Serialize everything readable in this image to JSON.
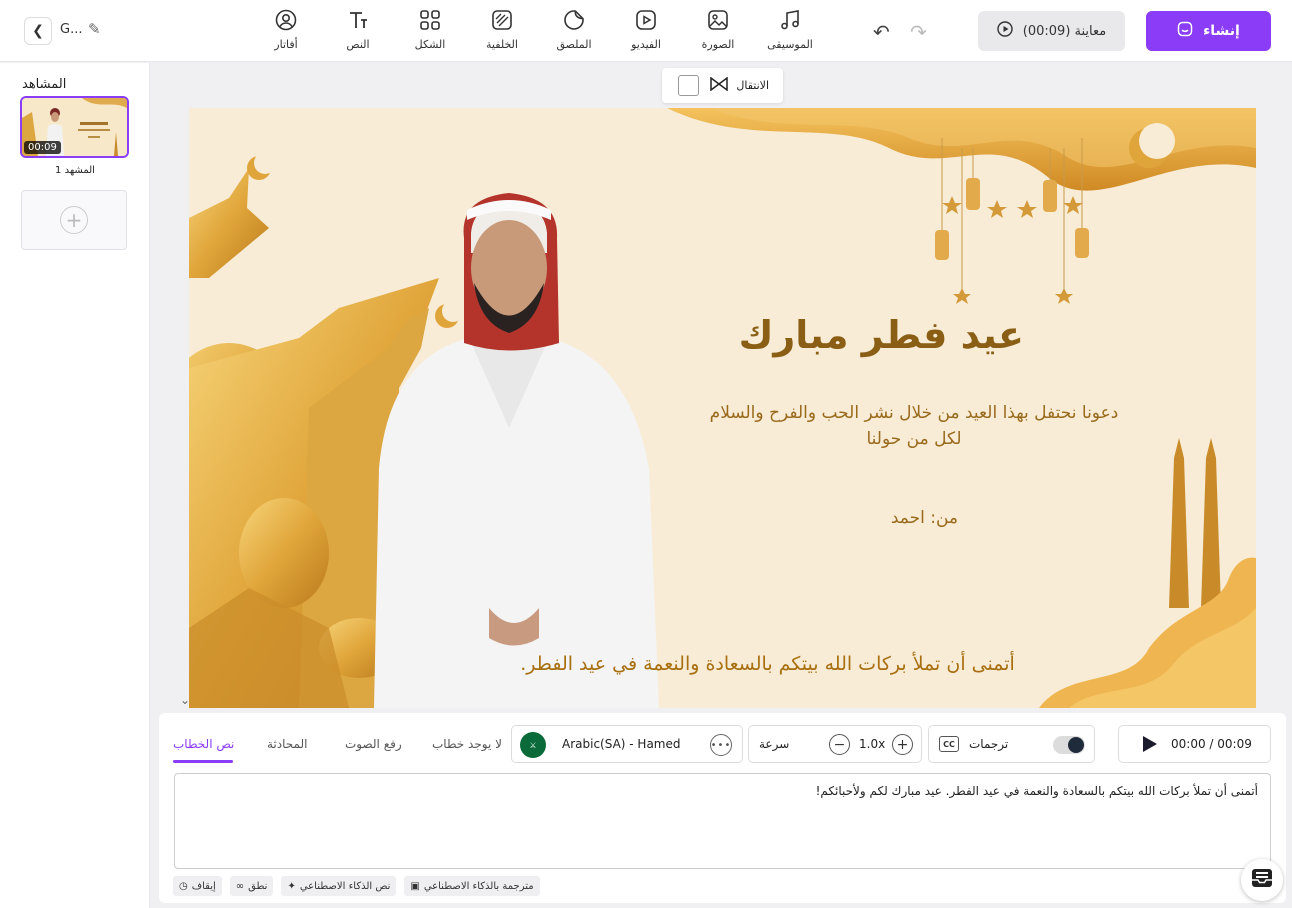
{
  "header": {
    "project_name": "G...",
    "toolbar": [
      {
        "label": "الموسيقى",
        "icon": "music-icon"
      },
      {
        "label": "الصورة",
        "icon": "image-icon"
      },
      {
        "label": "الفيديو",
        "icon": "video-icon"
      },
      {
        "label": "الملصق",
        "icon": "sticker-icon"
      },
      {
        "label": "الخلفية",
        "icon": "background-icon"
      },
      {
        "label": "الشكل",
        "icon": "shape-icon"
      },
      {
        "label": "النص",
        "icon": "text-icon"
      },
      {
        "label": "أفاتار",
        "icon": "avatar-icon"
      }
    ],
    "preview_label": "معاينة (00:09)",
    "create_label": "إنشاء"
  },
  "scenes": {
    "title": "المشاهد",
    "items": [
      {
        "name": "المشهد 1",
        "duration": "00:09"
      }
    ]
  },
  "transition": {
    "label": "الانتقال"
  },
  "canvas": {
    "title": "عيد فطر مبارك",
    "message": "دعونا نحتفل بهذا العيد من خلال نشر الحب والفرح والسلام لكل من حولنا",
    "from": "من: احمد",
    "caption": "أتمنى أن تملأ بركات الله بيتكم بالسعادة والنعمة في عيد الفطر."
  },
  "bottom": {
    "tabs": [
      {
        "label": "نص الخطاب",
        "active": true
      },
      {
        "label": "المحادثة",
        "active": false
      },
      {
        "label": "رفع الصوت",
        "active": false
      },
      {
        "label": "لا يوجد خطاب",
        "active": false
      }
    ],
    "voice": "Arabic(SA) - Hamed",
    "speed_label": "سرعة",
    "speed_value": "1.0x",
    "captions_label": "ترجمات",
    "captions_enabled": true,
    "time": "00:00 / 00:09",
    "script_text": "أتمنى أن تملأ بركات الله بيتكم بالسعادة والنعمة في عيد الفطر. عيد مبارك لكم ولأحبائكم!",
    "chips": [
      {
        "label": "إيقاف",
        "icon": "clock-icon"
      },
      {
        "label": "نطق",
        "icon": "glasses-icon"
      },
      {
        "label": "نص الذكاء الاصطناعي",
        "icon": "magic-wand-icon"
      },
      {
        "label": "مترجمة بالذكاء الاصطناعي",
        "icon": "translate-icon"
      }
    ]
  },
  "colors": {
    "accent": "#8b3cf7",
    "canvas_bg": "#f8ecd6",
    "gold": "#8a5e14"
  }
}
